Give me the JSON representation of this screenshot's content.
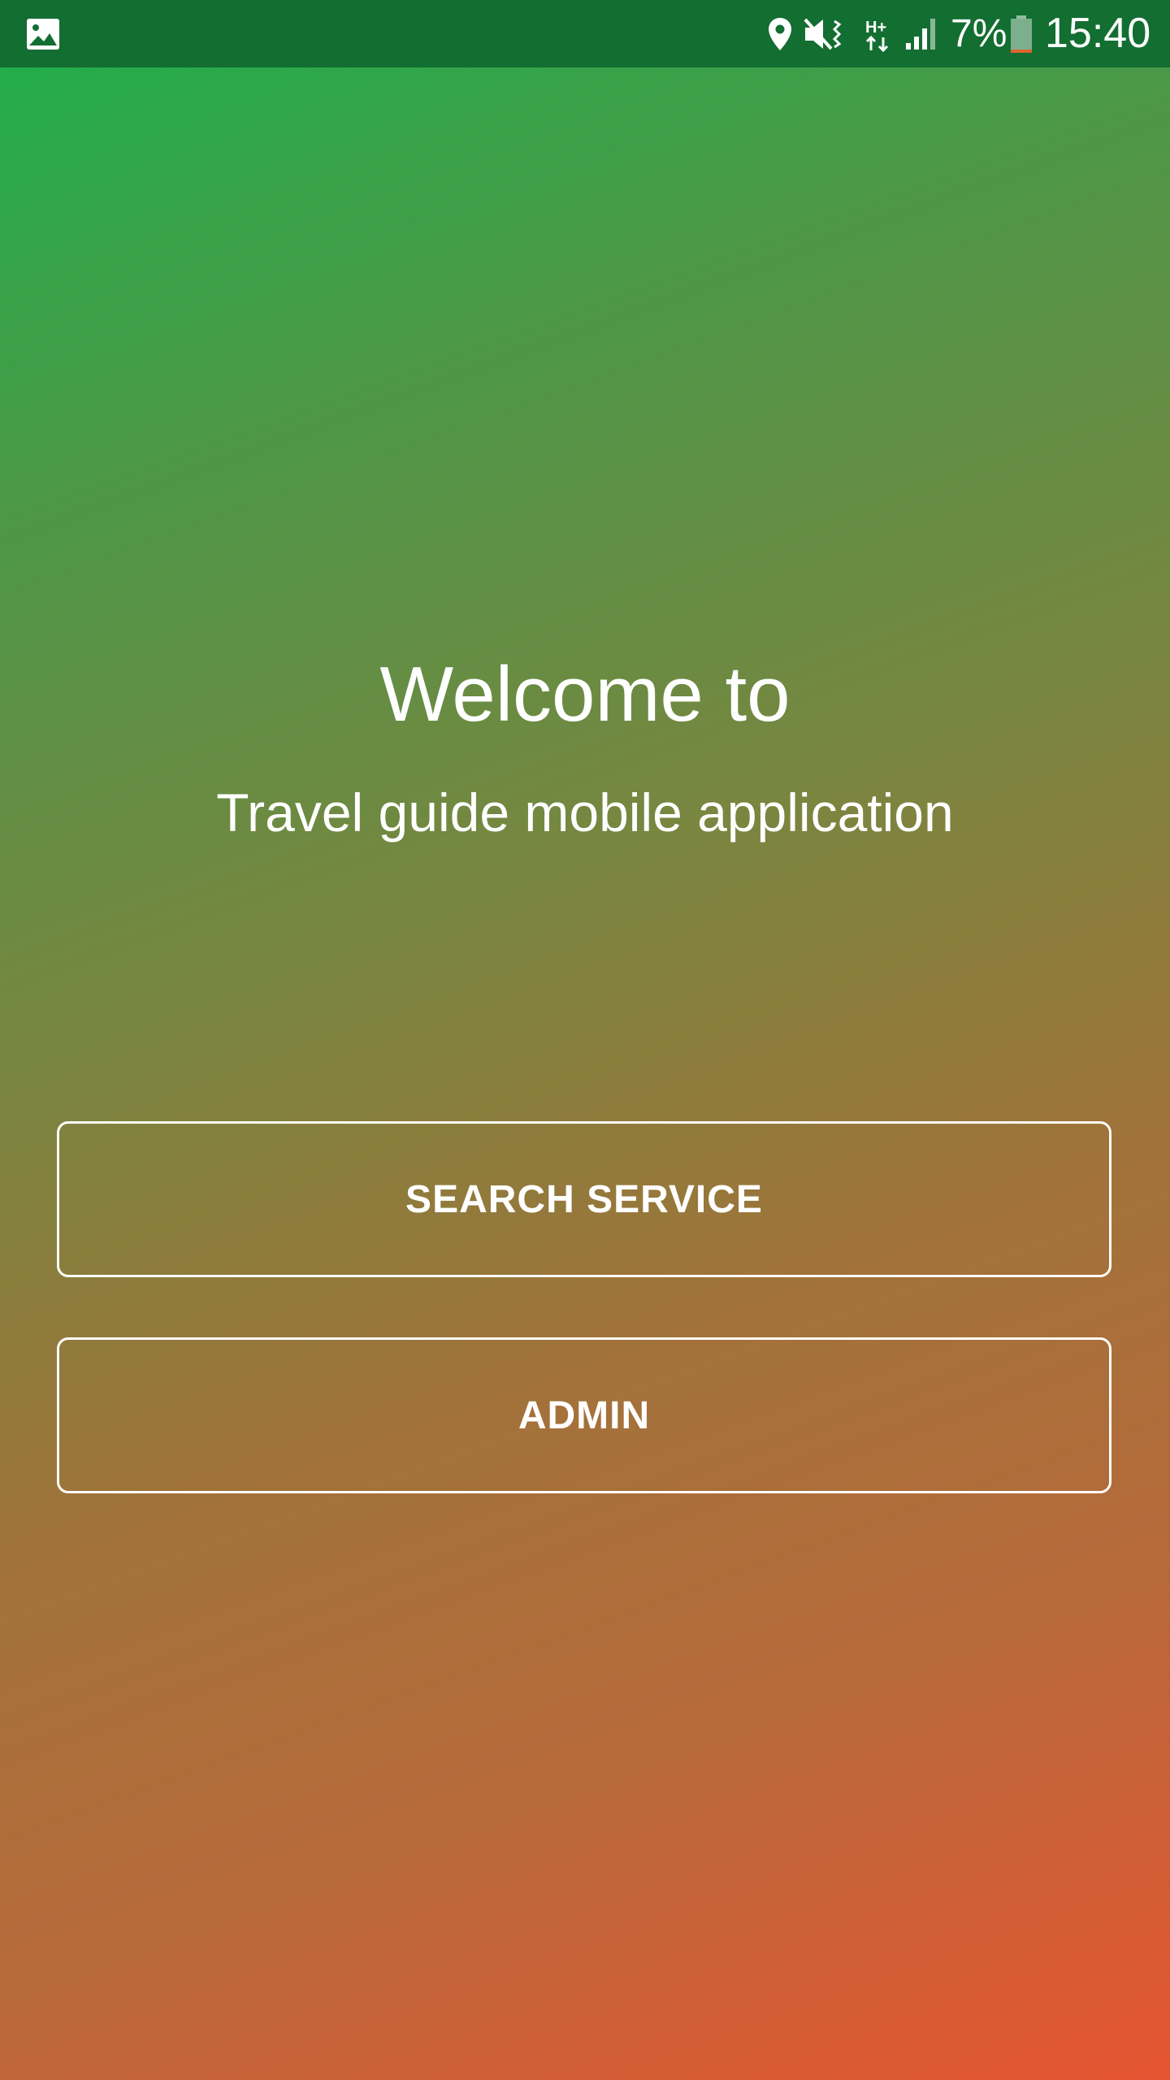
{
  "status_bar": {
    "icons": [
      "gallery-icon",
      "location-icon",
      "mute-vibrate-icon",
      "hplus-network-icon",
      "signal-icon",
      "battery-icon"
    ],
    "network_label": "H+",
    "battery_percent": "7%",
    "time": "15:40",
    "background_color": "#136e31"
  },
  "welcome": {
    "title": "Welcome to",
    "subtitle": "Travel guide mobile application"
  },
  "buttons": {
    "search_service": "SEARCH SERVICE",
    "admin": "ADMIN"
  },
  "colors": {
    "gradient_start": "#1db04c",
    "gradient_end": "#e65432",
    "text": "#ffffff"
  }
}
